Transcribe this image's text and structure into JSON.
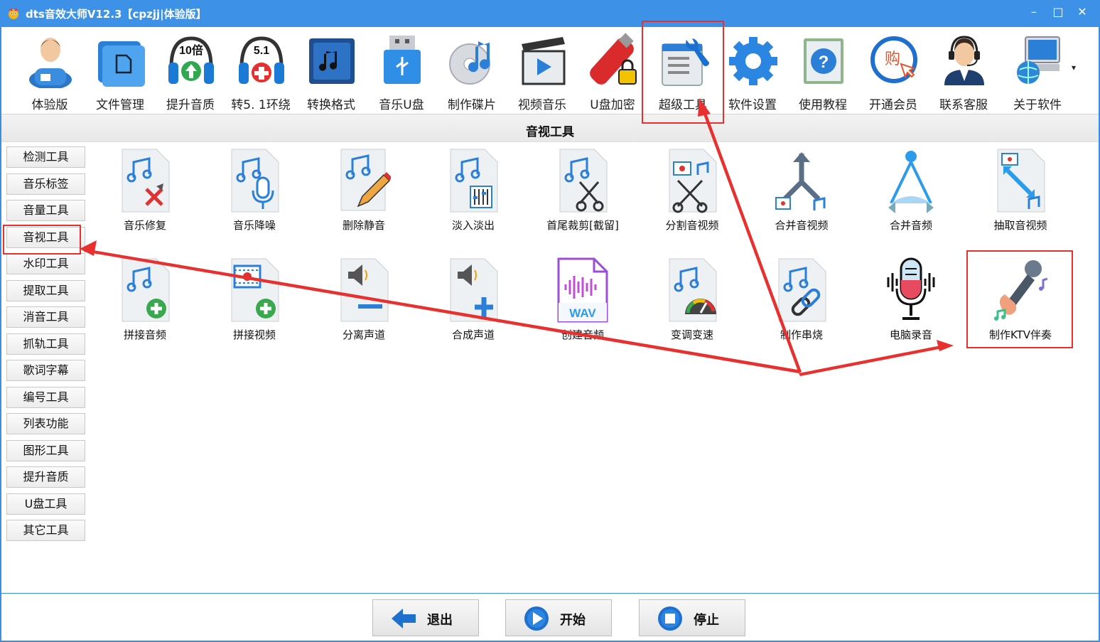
{
  "window": {
    "title": "dts音效大师V12.3【cpzjj|体验版】",
    "controls": [
      "–",
      "□",
      "✕"
    ]
  },
  "toolbar": {
    "items": [
      {
        "label": "体验版",
        "icon": "user-avatar-icon"
      },
      {
        "label": "文件管理",
        "icon": "folder-icon"
      },
      {
        "label": "提升音质",
        "icon": "headphones-10x-icon",
        "badge": "10倍"
      },
      {
        "label": "转5. 1环绕",
        "icon": "headphones-51-icon",
        "badge": "5.1"
      },
      {
        "label": "转换格式",
        "icon": "music-convert-icon"
      },
      {
        "label": "音乐U盘",
        "icon": "usb-drive-icon"
      },
      {
        "label": "制作碟片",
        "icon": "cd-disc-icon"
      },
      {
        "label": "视频音乐",
        "icon": "clapperboard-icon"
      },
      {
        "label": "U盘加密",
        "icon": "usb-lock-icon"
      },
      {
        "label": "超级工具",
        "icon": "wrench-tools-icon"
      },
      {
        "label": "软件设置",
        "icon": "gear-icon"
      },
      {
        "label": "使用教程",
        "icon": "help-book-icon"
      },
      {
        "label": "开通会员",
        "icon": "purchase-icon",
        "badge": "购"
      },
      {
        "label": "联系客服",
        "icon": "customer-service-icon"
      },
      {
        "label": "关于软件",
        "icon": "computer-globe-icon"
      }
    ],
    "more": "▾"
  },
  "section": {
    "title": "音视工具"
  },
  "sidebar": {
    "items": [
      "检测工具",
      "音乐标签",
      "音量工具",
      "音视工具",
      "水印工具",
      "提取工具",
      "消音工具",
      "抓轨工具",
      "歌词字幕",
      "编号工具",
      "列表功能",
      "图形工具",
      "提升音质",
      "U盘工具",
      "其它工具"
    ]
  },
  "tools": {
    "row1": [
      {
        "label": "音乐修复",
        "icon": "music-repair-icon"
      },
      {
        "label": "音乐降噪",
        "icon": "music-denoise-icon"
      },
      {
        "label": "删除静音",
        "icon": "remove-silence-icon"
      },
      {
        "label": "淡入淡出",
        "icon": "fade-in-out-icon"
      },
      {
        "label": "首尾裁剪[截留]",
        "icon": "trim-scissors-icon"
      },
      {
        "label": "分割音视频",
        "icon": "split-av-icon"
      },
      {
        "label": "合并音视频",
        "icon": "merge-av-icon"
      },
      {
        "label": "合并音频",
        "icon": "merge-audio-icon"
      },
      {
        "label": "抽取音视频",
        "icon": "extract-av-icon"
      }
    ],
    "row2": [
      {
        "label": "拼接音频",
        "icon": "join-audio-icon"
      },
      {
        "label": "拼接视频",
        "icon": "join-video-icon"
      },
      {
        "label": "分离声道",
        "icon": "separate-channel-icon"
      },
      {
        "label": "合成声道",
        "icon": "combine-channel-icon"
      },
      {
        "label": "创建音频",
        "icon": "wav-file-icon",
        "badge": "WAV"
      },
      {
        "label": "变调变速",
        "icon": "pitch-speed-icon"
      },
      {
        "label": "制作串烧",
        "icon": "medley-link-icon"
      },
      {
        "label": "电脑录音",
        "icon": "microphone-record-icon"
      },
      {
        "label": "制作KTV伴奏",
        "icon": "karaoke-mic-icon"
      }
    ]
  },
  "footer": {
    "exit": "退出",
    "start": "开始",
    "stop": "停止"
  },
  "colors": {
    "frame": "#3a8fe0",
    "highlight": "#e8312f",
    "icon_blue": "#2b7fd6"
  }
}
